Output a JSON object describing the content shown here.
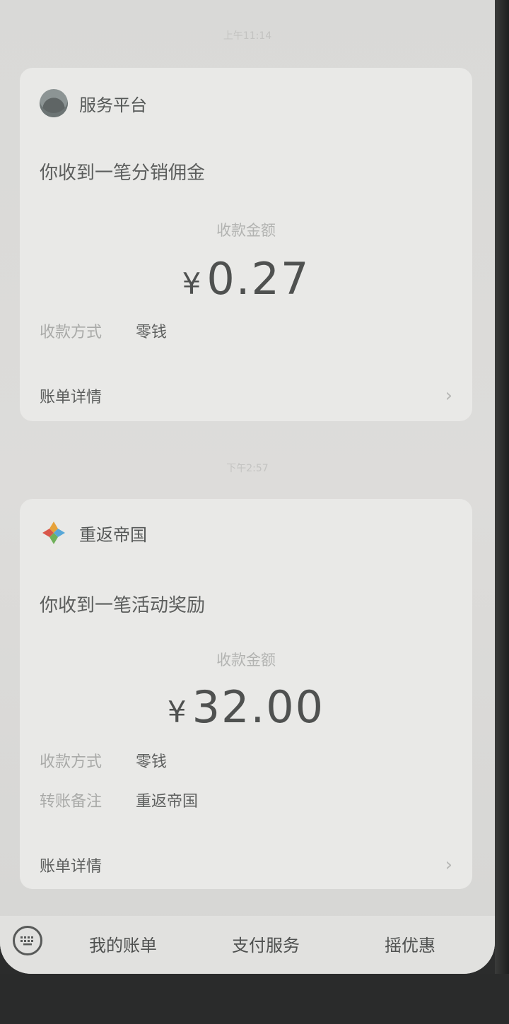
{
  "messages": [
    {
      "time": "上午11:14",
      "app_name": "服务平台",
      "app_icon": "avatar-icon",
      "headline": "你收到一笔分销佣金",
      "amount_label": "收款金额",
      "currency": "¥",
      "amount": "0.27",
      "fields": [
        {
          "label": "收款方式",
          "value": "零钱"
        }
      ],
      "details_label": "账单详情"
    },
    {
      "time": "下午2:57",
      "app_name": "重返帝国",
      "app_icon": "diamond-logo-icon",
      "headline": "你收到一笔活动奖励",
      "amount_label": "收款金额",
      "currency": "¥",
      "amount": "32.00",
      "fields": [
        {
          "label": "收款方式",
          "value": "零钱"
        },
        {
          "label": "转账备注",
          "value": "重返帝国"
        }
      ],
      "details_label": "账单详情"
    }
  ],
  "tabbar": {
    "keyboard_icon": "keyboard-icon",
    "tabs": [
      "我的账单",
      "支付服务",
      "摇优惠"
    ]
  },
  "colors": {
    "card": "#e9e9e7",
    "background": "#dcdcda",
    "text_primary": "#4f5150",
    "text_muted": "#a9aaa8"
  }
}
